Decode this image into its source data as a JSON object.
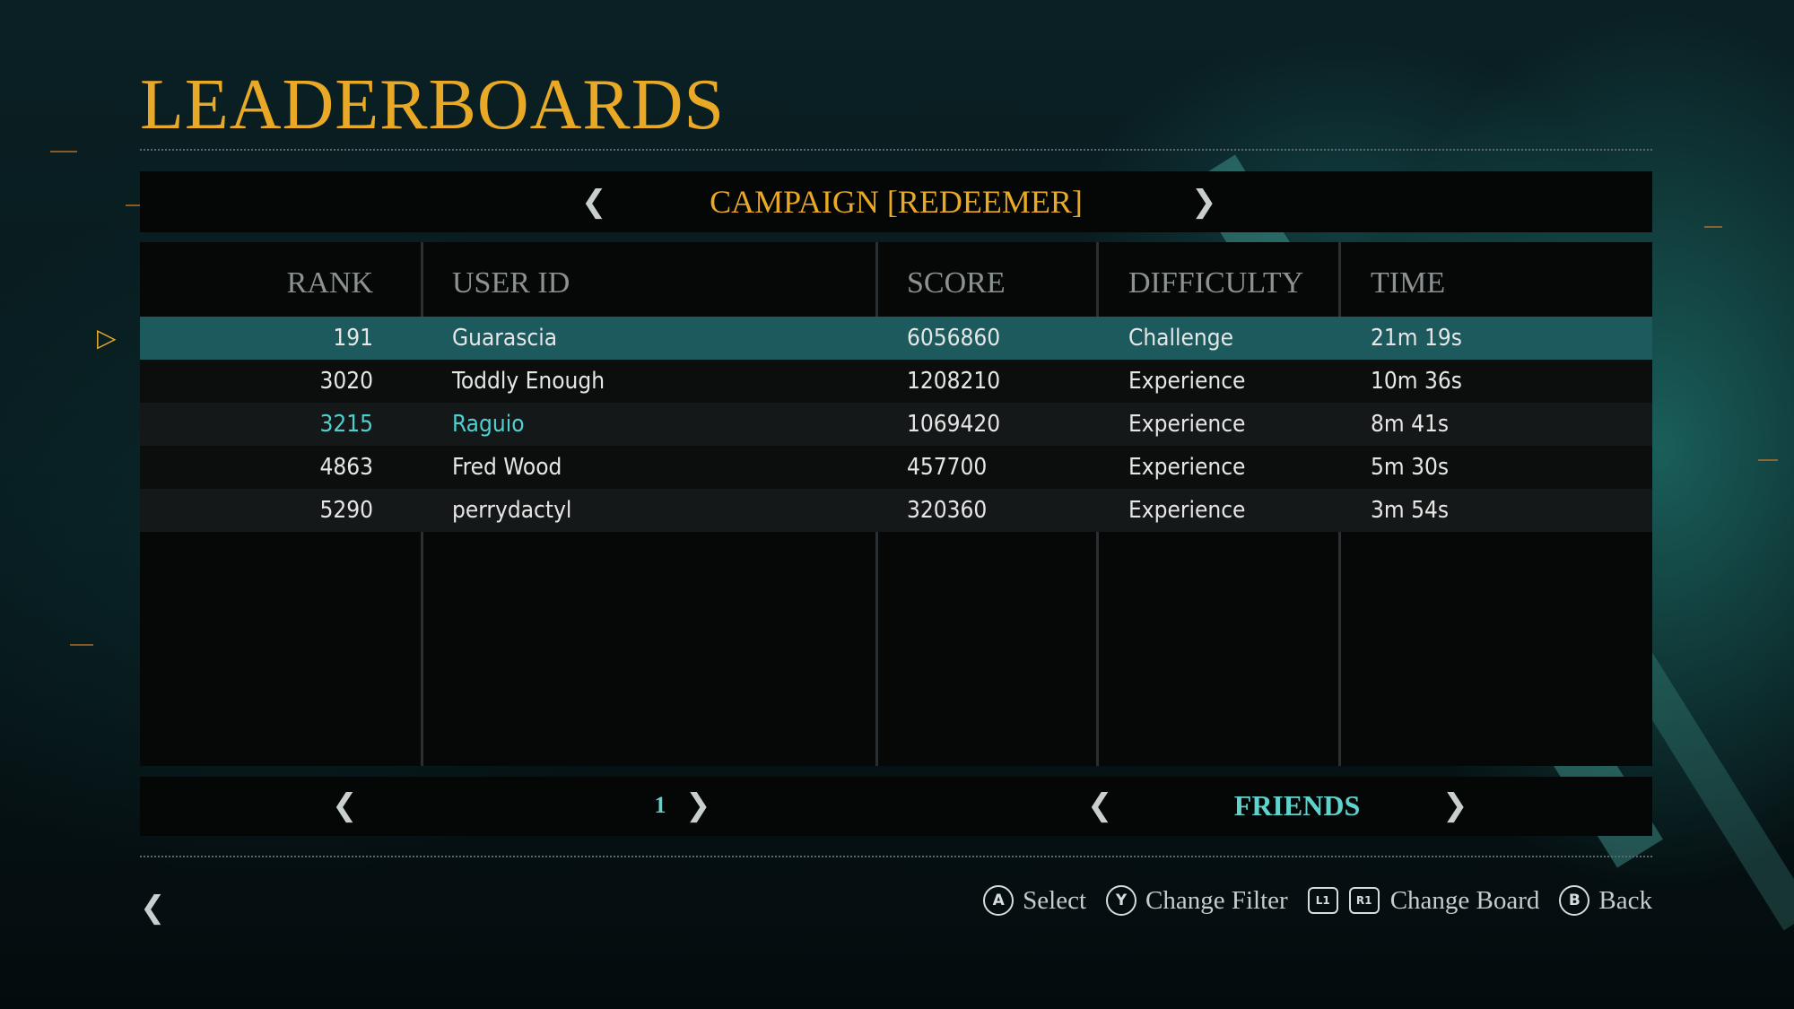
{
  "title": "LEADERBOARDS",
  "board": {
    "name": "CAMPAIGN [REDEEMER]"
  },
  "columns": {
    "rank": "RANK",
    "user": "USER ID",
    "score": "SCORE",
    "difficulty": "DIFFICULTY",
    "time": "TIME"
  },
  "rows": [
    {
      "rank": "191",
      "user": "Guarascia",
      "score": "6056860",
      "difficulty": "Challenge",
      "time": "21m 19s"
    },
    {
      "rank": "3020",
      "user": "Toddly Enough",
      "score": "1208210",
      "difficulty": "Experience",
      "time": "10m 36s"
    },
    {
      "rank": "3215",
      "user": "Raguio",
      "score": "1069420",
      "difficulty": "Experience",
      "time": "8m 41s"
    },
    {
      "rank": "4863",
      "user": "Fred Wood",
      "score": "457700",
      "difficulty": "Experience",
      "time": "5m 30s"
    },
    {
      "rank": "5290",
      "user": "perrydactyl",
      "score": "320360",
      "difficulty": "Experience",
      "time": "3m 54s"
    }
  ],
  "pager": {
    "page": "1",
    "filter": "FRIENDS"
  },
  "prompts": {
    "select": {
      "button": "A",
      "label": "Select"
    },
    "change_filter": {
      "button": "Y",
      "label": "Change Filter"
    },
    "change_board": {
      "button_left": "L1",
      "button_right": "R1",
      "label": "Change Board"
    },
    "back": {
      "button": "B",
      "label": "Back"
    }
  },
  "icons": {
    "prev": "chevron-left-icon",
    "next": "chevron-right-icon",
    "selection": "selection-pointer-icon"
  },
  "colors": {
    "accent": "#e9a927",
    "highlight": "#4fd0cf",
    "selected_row": "#1c5a5d"
  }
}
